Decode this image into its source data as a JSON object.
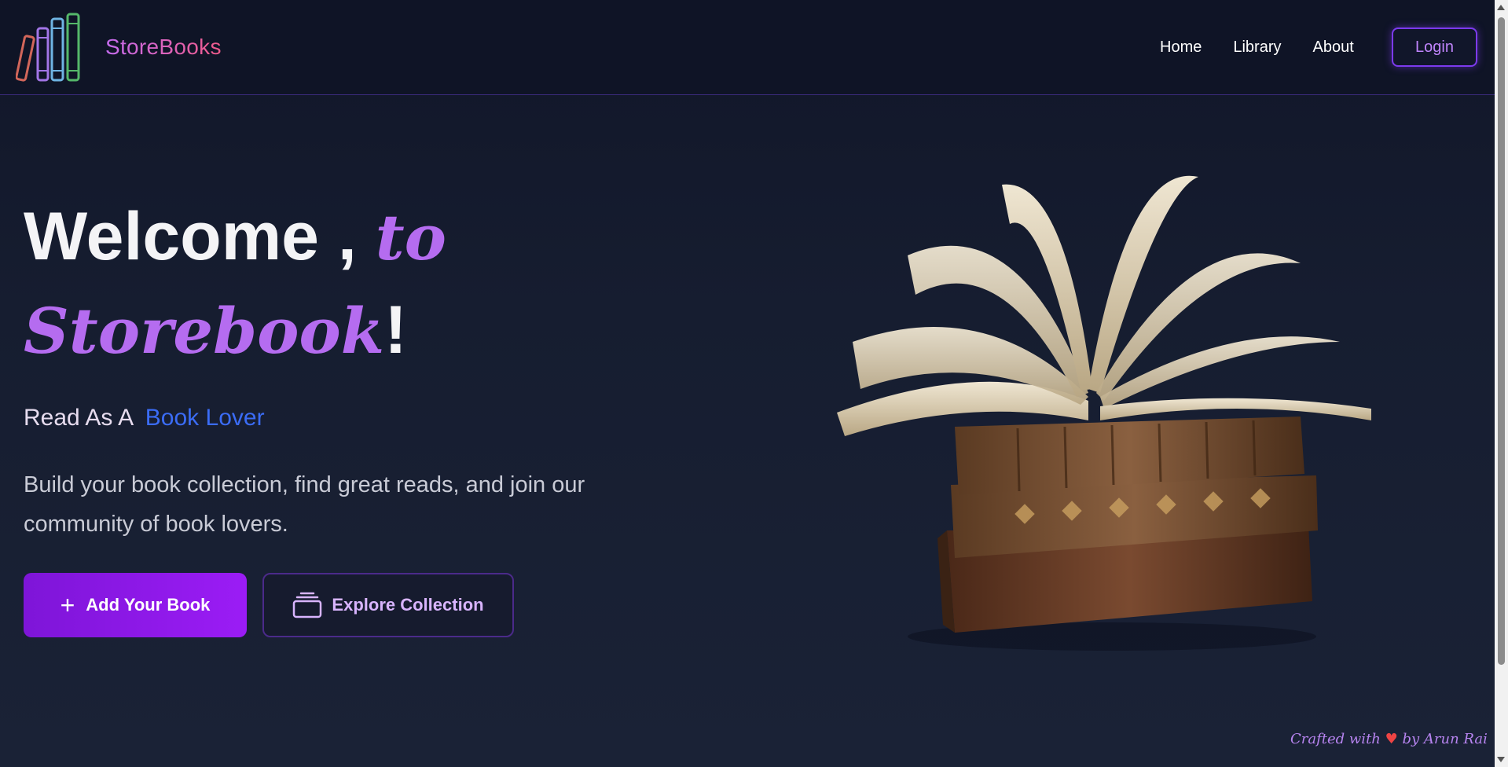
{
  "brand": {
    "name": "StoreBooks"
  },
  "nav": {
    "links": [
      "Home",
      "Library",
      "About"
    ],
    "login_label": "Login"
  },
  "hero": {
    "title_welcome": "Welcome , ",
    "title_to": "to",
    "title_storebook": "Storebook",
    "title_bang": "!",
    "tagline_prefix": "Read As A",
    "tagline_highlight": "Book Lover",
    "description": "Build your book collection, find great reads, and join our community of book lovers.",
    "add_button_icon": "+",
    "add_button_label": "Add Your Book",
    "explore_button_label": "Explore Collection"
  },
  "footer": {
    "credit_prefix": "Crafted with",
    "heart": "♥",
    "credit_suffix": "by Arun Rai"
  },
  "icons": {
    "logo": "books-logo-icon",
    "add": "plus-icon",
    "explore": "stack-icon",
    "hero_image": "book-stack-image"
  },
  "colors": {
    "accent_purple": "#b56cf0",
    "accent_blue": "#3b6cf6",
    "button_purple": "#9b1cf5",
    "background": "#161d30"
  }
}
